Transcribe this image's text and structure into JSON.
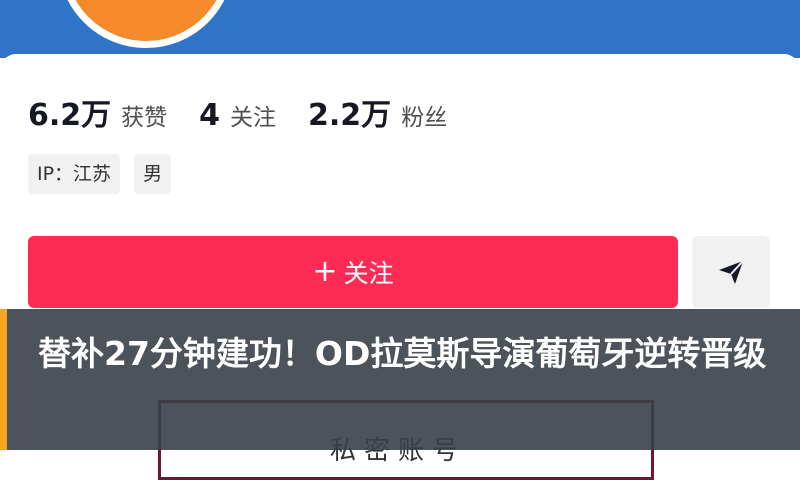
{
  "profile": {
    "stats": [
      {
        "value": "6.2万",
        "label": "获赞"
      },
      {
        "value": "4",
        "label": "关注"
      },
      {
        "value": "2.2万",
        "label": "粉丝"
      }
    ],
    "tags": [
      "IP：江苏",
      "男"
    ],
    "follow_button": {
      "icon": "plus-icon",
      "plus": "+",
      "label": "关注"
    },
    "share_button": {
      "icon": "send-icon"
    },
    "private_account_label": "私密账号"
  },
  "caption": {
    "text": "替补27分钟建功！OD拉莫斯导演葡萄牙逆转晋级"
  },
  "colors": {
    "banner": "#2f74c6",
    "avatar": "#f58a2a",
    "follow": "#fe2c55",
    "caption_accent": "#f5a623"
  }
}
